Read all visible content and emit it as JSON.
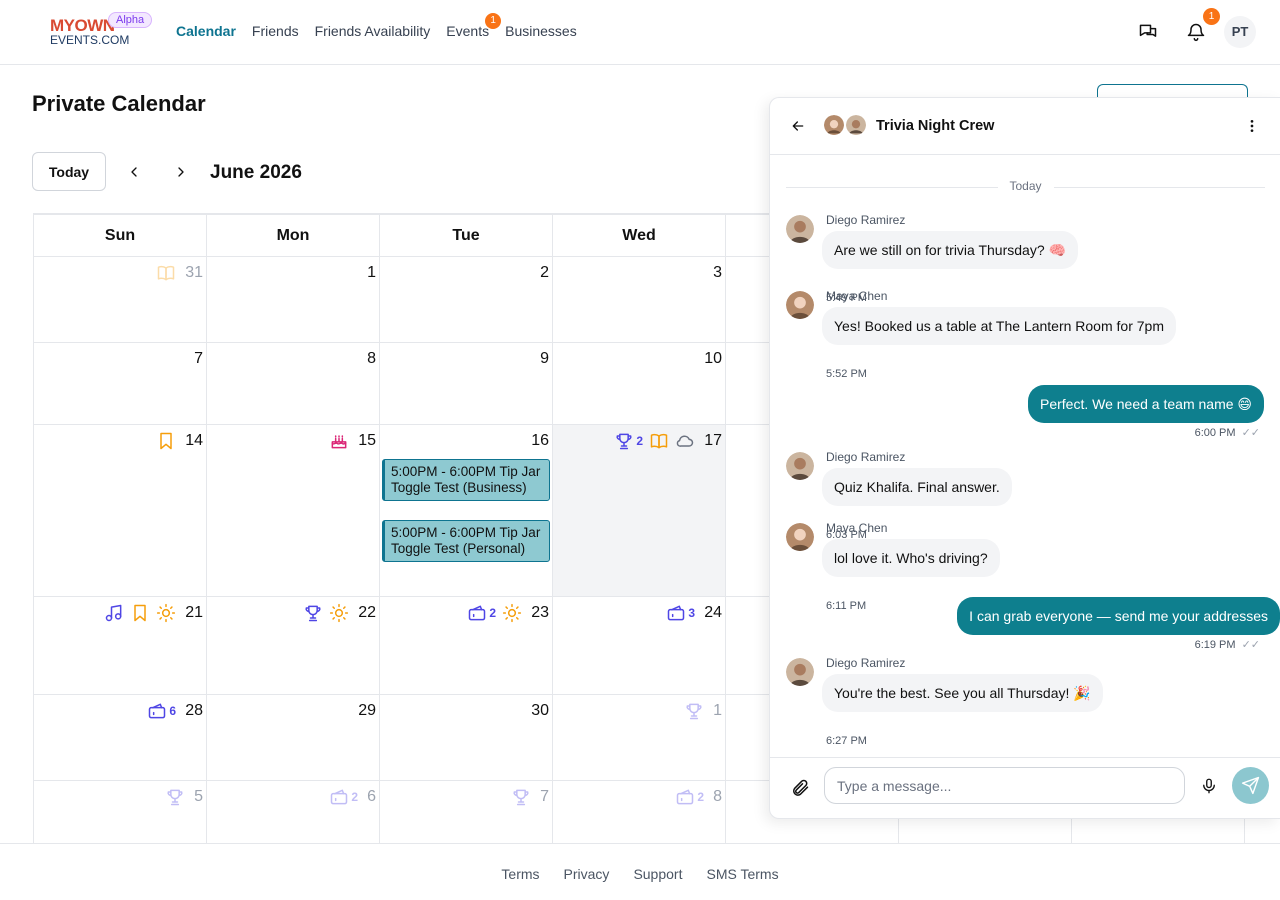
{
  "header": {
    "logo_lines": [
      "MYOWN",
      "EVENTS.COM"
    ],
    "alpha_badge": "Alpha",
    "nav": [
      {
        "label": "Calendar",
        "active": true
      },
      {
        "label": "Friends"
      },
      {
        "label": "Friends Availability"
      },
      {
        "label": "Events",
        "badge": "1"
      },
      {
        "label": "Businesses"
      }
    ],
    "notifications_count": "1",
    "user_initials": "PT"
  },
  "page": {
    "title": "Private Calendar",
    "today_label": "Today",
    "month_label": "June 2026"
  },
  "calendar": {
    "weekdays": [
      "Sun",
      "Mon",
      "Tue",
      "Wed"
    ],
    "weeks": [
      [
        {
          "day": "31",
          "muted": true,
          "icons": [
            {
              "icon": "book-icon",
              "color": "#f59e0b"
            }
          ]
        },
        {
          "day": "1"
        },
        {
          "day": "2"
        },
        {
          "day": "3"
        }
      ],
      [
        {
          "day": "7"
        },
        {
          "day": "8"
        },
        {
          "day": "9"
        },
        {
          "day": "10"
        }
      ],
      [
        {
          "day": "14",
          "icons": [
            {
              "icon": "bookmark-icon",
              "color": "#f59e0b"
            }
          ]
        },
        {
          "day": "15",
          "icons": [
            {
              "icon": "cake-icon",
              "color": "#db2777"
            }
          ]
        },
        {
          "day": "16",
          "events": [
            "5:00PM - 6:00PM Tip Jar Toggle Test (Business)",
            "5:00PM - 6:00PM Tip Jar Toggle Test (Personal)"
          ]
        },
        {
          "day": "17",
          "shaded": true,
          "icons": [
            {
              "icon": "trophy-icon",
              "color": "#4f46e5",
              "count": "2"
            },
            {
              "icon": "book-icon",
              "color": "#f59e0b"
            },
            {
              "icon": "cloud-icon",
              "color": "#6b7280"
            }
          ]
        }
      ],
      [
        {
          "day": "21",
          "icons": [
            {
              "icon": "music-icon",
              "color": "#4f46e5"
            },
            {
              "icon": "bookmark-icon",
              "color": "#f59e0b"
            },
            {
              "icon": "sun-icon",
              "color": "#f59e0b"
            }
          ]
        },
        {
          "day": "22",
          "icons": [
            {
              "icon": "trophy-icon",
              "color": "#4f46e5"
            },
            {
              "icon": "sun-icon",
              "color": "#f59e0b"
            }
          ]
        },
        {
          "day": "23",
          "icons": [
            {
              "icon": "ticket-icon",
              "color": "#4f46e5",
              "count": "2"
            },
            {
              "icon": "sun-icon",
              "color": "#f59e0b"
            }
          ]
        },
        {
          "day": "24",
          "icons": [
            {
              "icon": "ticket-icon",
              "color": "#4f46e5",
              "count": "3"
            }
          ]
        }
      ],
      [
        {
          "day": "28",
          "icons": [
            {
              "icon": "ticket-icon",
              "color": "#4f46e5",
              "count": "6"
            }
          ]
        },
        {
          "day": "29"
        },
        {
          "day": "30"
        },
        {
          "day": "1",
          "muted": true,
          "icons": [
            {
              "icon": "trophy-icon",
              "color": "#4f46e5"
            }
          ]
        }
      ],
      [
        {
          "day": "5",
          "muted": true,
          "icons": [
            {
              "icon": "trophy-icon",
              "color": "#4f46e5"
            }
          ]
        },
        {
          "day": "6",
          "muted": true,
          "icons": [
            {
              "icon": "ticket-icon",
              "color": "#4f46e5",
              "count": "2"
            }
          ]
        },
        {
          "day": "7",
          "muted": true,
          "icons": [
            {
              "icon": "trophy-icon",
              "color": "#4f46e5"
            }
          ]
        },
        {
          "day": "8",
          "muted": true,
          "icons": [
            {
              "icon": "ticket-icon",
              "color": "#4f46e5",
              "count": "2"
            }
          ]
        }
      ]
    ]
  },
  "chat": {
    "title": "Trivia Night Crew",
    "day_separator": "Today",
    "messages": [
      {
        "sender": "Diego Ramirez",
        "text": "Are we still on for trivia Thursday? 🧠",
        "time": "5:49 PM",
        "outgoing": false
      },
      {
        "sender": "Maya Chen",
        "text": "Yes! Booked us a table at The Lantern Room for 7pm",
        "time": "5:52 PM",
        "outgoing": false
      },
      {
        "text": "Perfect. We need a team name 😄",
        "time": "6:00 PM",
        "outgoing": true
      },
      {
        "sender": "Diego Ramirez",
        "text": "Quiz Khalifa. Final answer.",
        "time": "6:03 PM",
        "outgoing": false
      },
      {
        "sender": "Maya Chen",
        "text": "lol love it. Who's driving?",
        "time": "6:11 PM",
        "outgoing": false
      },
      {
        "text": "I can grab everyone — send me your addresses",
        "time": "6:19 PM",
        "outgoing": true
      },
      {
        "sender": "Diego Ramirez",
        "text": "You're the best. See you all Thursday! 🎉",
        "time": "6:27 PM",
        "outgoing": false
      }
    ],
    "input_placeholder": "Type a message..."
  },
  "footer": {
    "links": [
      "Terms",
      "Privacy",
      "Support",
      "SMS Terms"
    ]
  },
  "colors": {
    "accent": "#0e7490",
    "bubble_out": "#0e7f8e",
    "event_bg": "#8ec9d1",
    "badge": "#f97316"
  }
}
